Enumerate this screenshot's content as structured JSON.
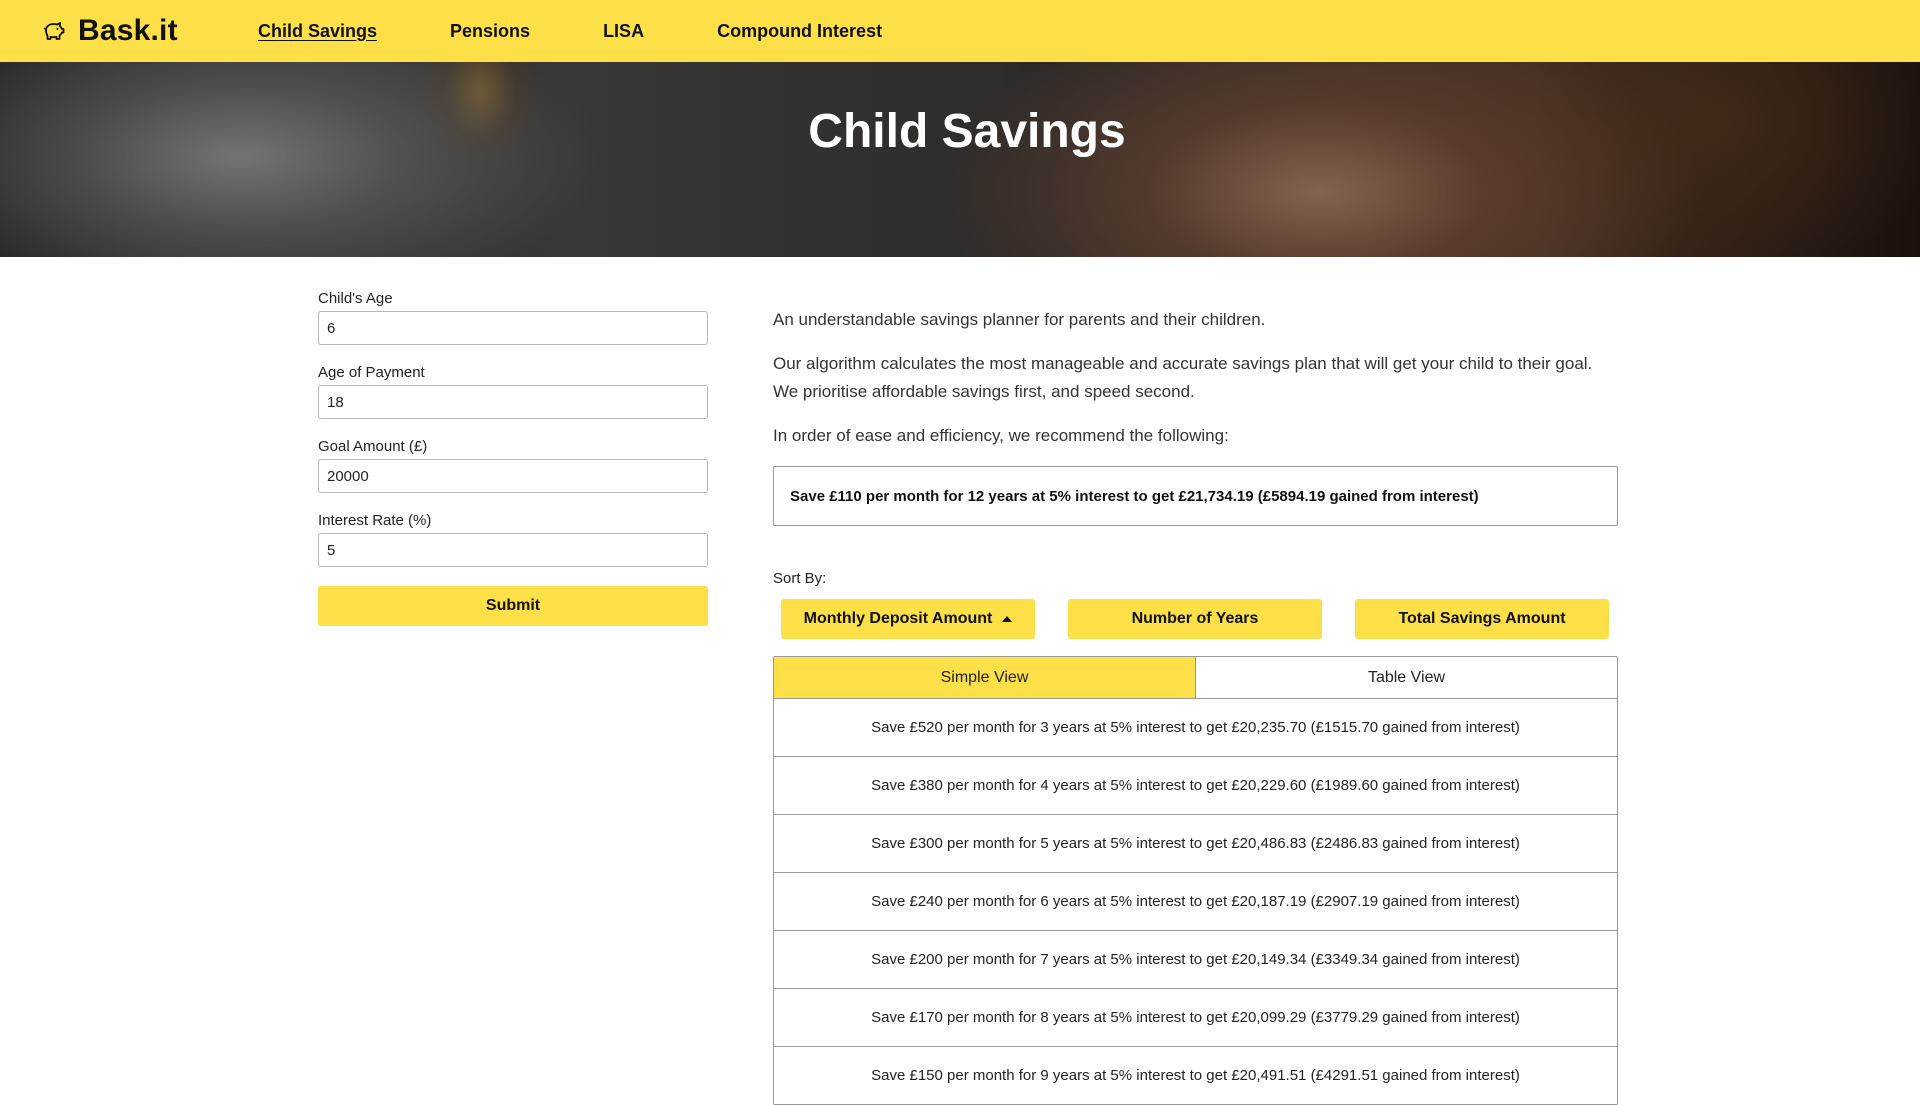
{
  "brand": {
    "name": "Bask.it",
    "icon": "piggy-bank-icon"
  },
  "nav": {
    "items": [
      {
        "label": "Child Savings",
        "active": true
      },
      {
        "label": "Pensions",
        "active": false
      },
      {
        "label": "LISA",
        "active": false
      },
      {
        "label": "Compound Interest",
        "active": false
      }
    ]
  },
  "hero": {
    "title": "Child Savings"
  },
  "form": {
    "fields": [
      {
        "label": "Child's Age",
        "value": "6"
      },
      {
        "label": "Age of Payment",
        "value": "18"
      },
      {
        "label": "Goal Amount (£)",
        "value": "20000"
      },
      {
        "label": "Interest Rate (%)",
        "value": "5"
      }
    ],
    "submit_label": "Submit"
  },
  "content": {
    "intro": "An understandable savings planner for parents and their children.",
    "description": "Our algorithm calculates the most manageable and accurate savings plan that will get your child to their goal. We prioritise affordable savings first, and speed second.",
    "recommend_label": "In order of ease and efficiency, we recommend the following:",
    "recommended": "Save £110 per month for 12 years at 5% interest to get £21,734.19 (£5894.19 gained from interest)"
  },
  "sort": {
    "label": "Sort By:",
    "buttons": [
      {
        "label": "Monthly Deposit Amount",
        "active": true
      },
      {
        "label": "Number of Years",
        "active": false
      },
      {
        "label": "Total Savings Amount",
        "active": false
      }
    ]
  },
  "views": {
    "tabs": [
      {
        "label": "Simple View",
        "active": true
      },
      {
        "label": "Table View",
        "active": false
      }
    ]
  },
  "results": [
    "Save £520 per month for 3 years at 5% interest to get £20,235.70 (£1515.70 gained from interest)",
    "Save £380 per month for 4 years at 5% interest to get £20,229.60 (£1989.60 gained from interest)",
    "Save £300 per month for 5 years at 5% interest to get £20,486.83 (£2486.83 gained from interest)",
    "Save £240 per month for 6 years at 5% interest to get £20,187.19 (£2907.19 gained from interest)",
    "Save £200 per month for 7 years at 5% interest to get £20,149.34 (£3349.34 gained from interest)",
    "Save £170 per month for 8 years at 5% interest to get £20,099.29 (£3779.29 gained from interest)",
    "Save £150 per month for 9 years at 5% interest to get £20,491.51 (£4291.51 gained from interest)"
  ],
  "colors": {
    "accent": "#fddf47",
    "border": "#999999",
    "text": "#222222"
  }
}
